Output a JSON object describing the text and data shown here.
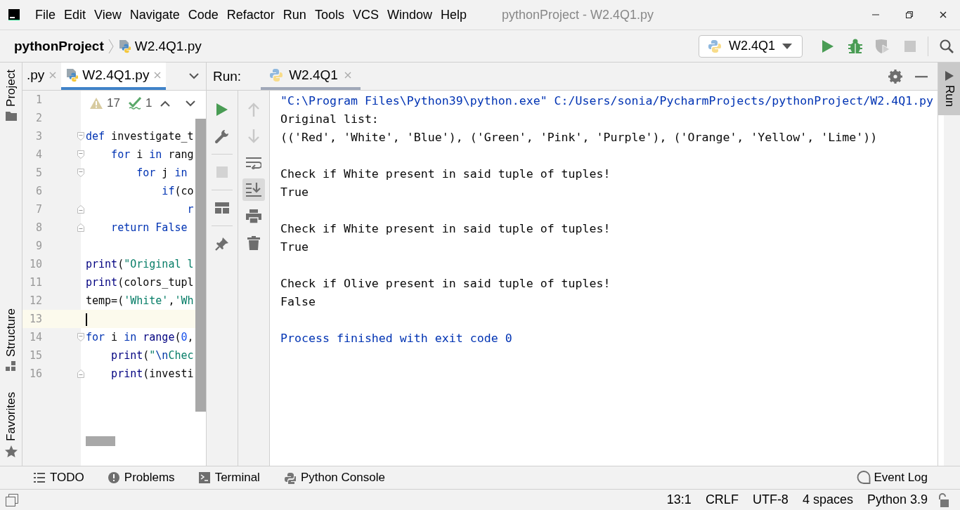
{
  "window": {
    "title": "pythonProject - W2.4Q1.py"
  },
  "menu": [
    {
      "label": "File"
    },
    {
      "label": "Edit"
    },
    {
      "label": "View"
    },
    {
      "label": "Navigate"
    },
    {
      "label": "Code"
    },
    {
      "label": "Refactor"
    },
    {
      "label": "Run"
    },
    {
      "label": "Tools"
    },
    {
      "label": "VCS"
    },
    {
      "label": "Window"
    },
    {
      "label": "Help"
    }
  ],
  "breadcrumb": {
    "project": "pythonProject",
    "file": "W2.4Q1.py"
  },
  "run_config": {
    "label": "W2.4Q1"
  },
  "nav_actions": [
    {
      "kind": "run",
      "disabled": false
    },
    {
      "kind": "debug",
      "disabled": false
    },
    {
      "kind": "coverage",
      "disabled": true
    },
    {
      "kind": "stop",
      "disabled": true
    },
    {
      "kind": "search",
      "disabled": false
    }
  ],
  "left_strip": [
    {
      "kind": "project",
      "label": "Project"
    },
    {
      "kind": "structure",
      "label": "Structure"
    },
    {
      "kind": "favorites",
      "label": "Favorites"
    }
  ],
  "editor": {
    "tabs": [
      {
        "label": ".py",
        "selected": false
      },
      {
        "label": "W2.4Q1.py",
        "selected": true
      }
    ],
    "inspections": {
      "warnings": "17",
      "typos": "1"
    },
    "lines": [
      {
        "number": "1",
        "fold_start": false,
        "fold_end": false,
        "current": false
      },
      {
        "number": "2",
        "fold_start": false,
        "fold_end": false,
        "current": false
      },
      {
        "number": "3",
        "fold_start": true,
        "fold_end": false,
        "current": false,
        "tokens": [
          {
            "kind": "keyword",
            "text": "def"
          },
          {
            "kind": "plain",
            "text": " investigate_t"
          }
        ]
      },
      {
        "number": "4",
        "fold_start": true,
        "fold_end": false,
        "current": false,
        "tokens": [
          {
            "kind": "keyword",
            "text": "    for"
          },
          {
            "kind": "plain",
            "text": " i "
          },
          {
            "kind": "keyword",
            "text": "in"
          },
          {
            "kind": "plain",
            "text": " rang"
          }
        ]
      },
      {
        "number": "5",
        "fold_start": true,
        "fold_end": false,
        "current": false,
        "tokens": [
          {
            "kind": "keyword",
            "text": "        for"
          },
          {
            "kind": "plain",
            "text": " j "
          },
          {
            "kind": "keyword",
            "text": "in"
          }
        ]
      },
      {
        "number": "6",
        "fold_start": false,
        "fold_end": false,
        "current": false,
        "tokens": [
          {
            "kind": "keyword",
            "text": "            if"
          },
          {
            "kind": "plain",
            "text": "(co"
          }
        ]
      },
      {
        "number": "7",
        "fold_start": false,
        "fold_end": true,
        "current": false,
        "tokens": [
          {
            "kind": "keyword",
            "text": "                r"
          }
        ]
      },
      {
        "number": "8",
        "fold_start": false,
        "fold_end": true,
        "current": false,
        "tokens": [
          {
            "kind": "keyword",
            "text": "    return False"
          }
        ]
      },
      {
        "number": "9",
        "fold_start": false,
        "fold_end": false,
        "current": false
      },
      {
        "number": "10",
        "fold_start": false,
        "fold_end": false,
        "current": false,
        "tokens": [
          {
            "kind": "builtin",
            "text": "print"
          },
          {
            "kind": "plain",
            "text": "("
          },
          {
            "kind": "string",
            "text": "\"Original l"
          }
        ]
      },
      {
        "number": "11",
        "fold_start": false,
        "fold_end": false,
        "current": false,
        "tokens": [
          {
            "kind": "builtin",
            "text": "print"
          },
          {
            "kind": "plain",
            "text": "(colors_tupl"
          }
        ]
      },
      {
        "number": "12",
        "fold_start": false,
        "fold_end": false,
        "current": false,
        "tokens": [
          {
            "kind": "plain",
            "text": "temp=("
          },
          {
            "kind": "string",
            "text": "'White'"
          },
          {
            "kind": "plain",
            "text": ","
          },
          {
            "kind": "string",
            "text": "'Wh"
          }
        ]
      },
      {
        "number": "13",
        "fold_start": false,
        "fold_end": false,
        "current": true
      },
      {
        "number": "14",
        "fold_start": true,
        "fold_end": false,
        "current": false,
        "tokens": [
          {
            "kind": "keyword",
            "text": "for"
          },
          {
            "kind": "plain",
            "text": " i "
          },
          {
            "kind": "keyword",
            "text": "in"
          },
          {
            "kind": "builtin",
            "text": " range"
          },
          {
            "kind": "plain",
            "text": "("
          },
          {
            "kind": "number",
            "text": "0"
          },
          {
            "kind": "plain",
            "text": ","
          }
        ]
      },
      {
        "number": "15",
        "fold_start": false,
        "fold_end": false,
        "current": false,
        "tokens": [
          {
            "kind": "builtin",
            "text": "    print"
          },
          {
            "kind": "plain",
            "text": "("
          },
          {
            "kind": "string",
            "text": "\""
          },
          {
            "kind": "escape",
            "text": "\\n"
          },
          {
            "kind": "string",
            "text": "Chec"
          }
        ]
      },
      {
        "number": "16",
        "fold_start": false,
        "fold_end": true,
        "current": false,
        "tokens": [
          {
            "kind": "builtin",
            "text": "    print"
          },
          {
            "kind": "plain",
            "text": "(investi"
          }
        ]
      }
    ]
  },
  "run_panel": {
    "label": "Run:",
    "tabs": [
      {
        "label": "W2.4Q1",
        "selected": true
      }
    ],
    "toolbar": [
      {
        "kind": "rerun",
        "disabled": false,
        "separated": false
      },
      {
        "kind": "wrench",
        "disabled": false,
        "separated": false
      },
      {
        "kind": "stop",
        "disabled": true,
        "separated": true
      },
      {
        "kind": "layout",
        "disabled": false,
        "separated": true
      },
      {
        "kind": "pin",
        "disabled": false,
        "separated": true
      }
    ],
    "toolbar_2": [
      {
        "kind": "up",
        "disabled": true,
        "active": false
      },
      {
        "kind": "down",
        "disabled": true,
        "active": false
      },
      {
        "kind": "wrap",
        "disabled": false,
        "active": false
      },
      {
        "kind": "scroll-end",
        "disabled": false,
        "active": true
      },
      {
        "kind": "print",
        "disabled": false,
        "active": false
      },
      {
        "kind": "clear",
        "disabled": false,
        "active": false
      }
    ],
    "console": [
      {
        "kind": "command",
        "text": "\"C:\\Program Files\\Python39\\python.exe\" C:/Users/sonia/PycharmProjects/pythonProject/W2.4Q1.py"
      },
      {
        "kind": "output",
        "text": "Original list:"
      },
      {
        "kind": "output",
        "text": "(('Red', 'White', 'Blue'), ('Green', 'Pink', 'Purple'), ('Orange', 'Yellow', 'Lime'))"
      },
      {
        "kind": "blank"
      },
      {
        "kind": "output",
        "text": "Check if White present in said tuple of tuples!"
      },
      {
        "kind": "output",
        "text": "True"
      },
      {
        "kind": "blank"
      },
      {
        "kind": "output",
        "text": "Check if White present in said tuple of tuples!"
      },
      {
        "kind": "output",
        "text": "True"
      },
      {
        "kind": "blank"
      },
      {
        "kind": "output",
        "text": "Check if Olive present in said tuple of tuples!"
      },
      {
        "kind": "output",
        "text": "False"
      },
      {
        "kind": "blank"
      },
      {
        "kind": "exit",
        "text": "Process finished with exit code 0"
      }
    ]
  },
  "right_strip": [
    {
      "label": "Run",
      "selected": true
    }
  ],
  "tool_windows": [
    {
      "kind": "todo",
      "label": "TODO"
    },
    {
      "kind": "problems",
      "label": "Problems"
    },
    {
      "kind": "terminal",
      "label": "Terminal"
    },
    {
      "kind": "python-console",
      "label": "Python Console"
    }
  ],
  "event_log": {
    "label": "Event Log"
  },
  "status_bar": {
    "items": [
      "13:1",
      "CRLF",
      "UTF-8",
      "4 spaces",
      "Python 3.9"
    ]
  }
}
